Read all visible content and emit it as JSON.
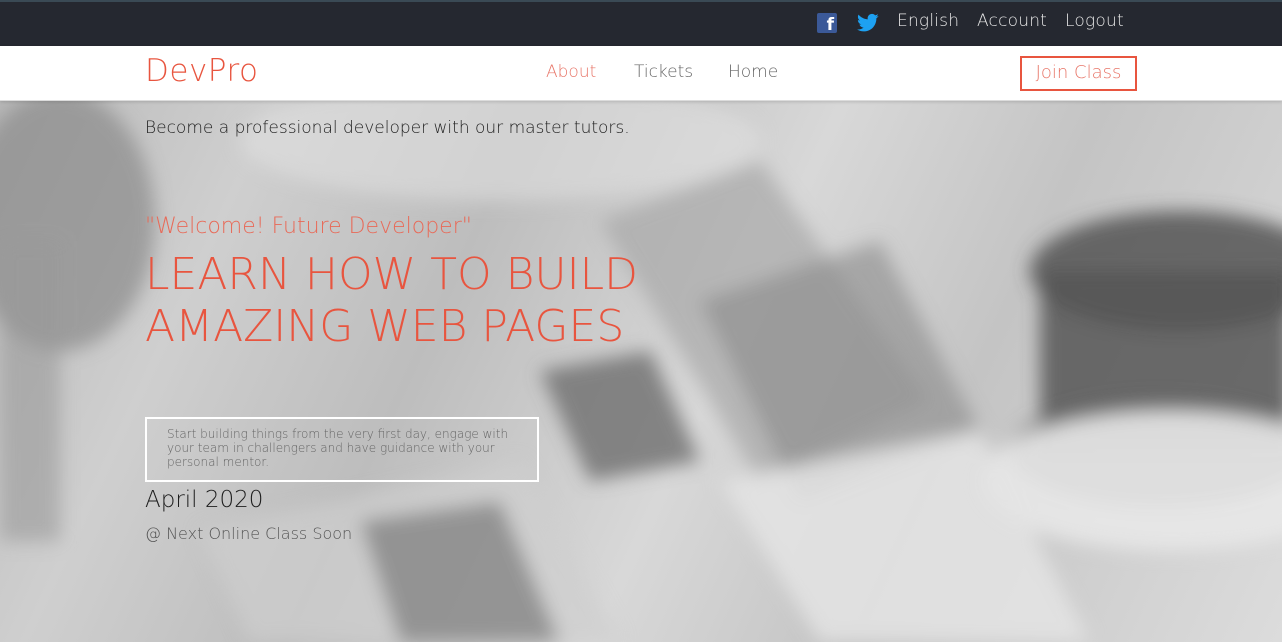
{
  "topbar": {
    "facebook_icon": "facebook-icon",
    "twitter_icon": "twitter-icon",
    "language": "English",
    "account": "Account",
    "logout": "Logout",
    "colors": {
      "background": "#252830",
      "facebook": "#3b5998",
      "twitter": "#1da1f2"
    }
  },
  "navbar": {
    "brand": "DevPro",
    "links": [
      {
        "label": "About",
        "active": true
      },
      {
        "label": "Tickets",
        "active": false
      },
      {
        "label": "Home",
        "active": false
      }
    ],
    "cta": "Join Class",
    "colors": {
      "accent": "#e8553f"
    }
  },
  "hero": {
    "tagline": "Become a professional developer with our master tutors.",
    "welcome": "\"Welcome! Future Developer\"",
    "headline": "LEARN HOW TO BUILD AMAZING WEB PAGES",
    "intro": "Start building things from the very first day, engage with your team in challengers and have guidance with your personal mentor.",
    "date": "April 2020",
    "next_class": "@ Next Online Class Soon"
  }
}
